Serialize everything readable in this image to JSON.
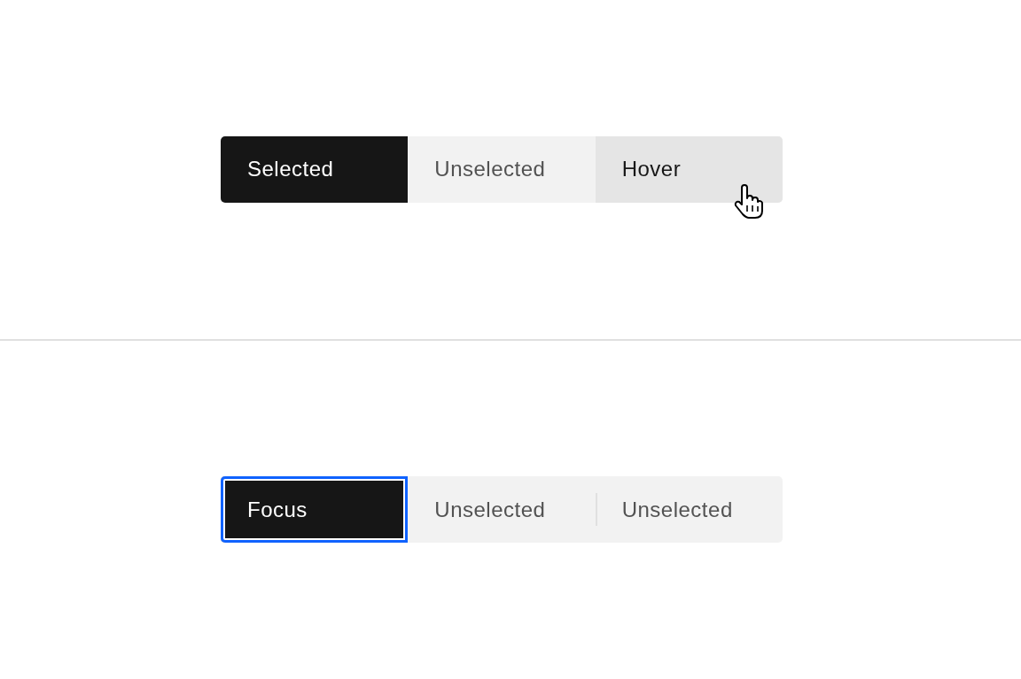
{
  "switchers": [
    {
      "items": [
        {
          "label": "Selected",
          "selected": true,
          "hovered": false,
          "focused": false
        },
        {
          "label": "Unselected",
          "selected": false,
          "hovered": false,
          "focused": false
        },
        {
          "label": "Hover",
          "selected": false,
          "hovered": true,
          "focused": false
        }
      ]
    },
    {
      "items": [
        {
          "label": "Focus",
          "selected": true,
          "hovered": false,
          "focused": true
        },
        {
          "label": "Unselected",
          "selected": false,
          "hovered": false,
          "focused": false
        },
        {
          "label": "Unselected",
          "selected": false,
          "hovered": false,
          "focused": false
        }
      ]
    }
  ]
}
